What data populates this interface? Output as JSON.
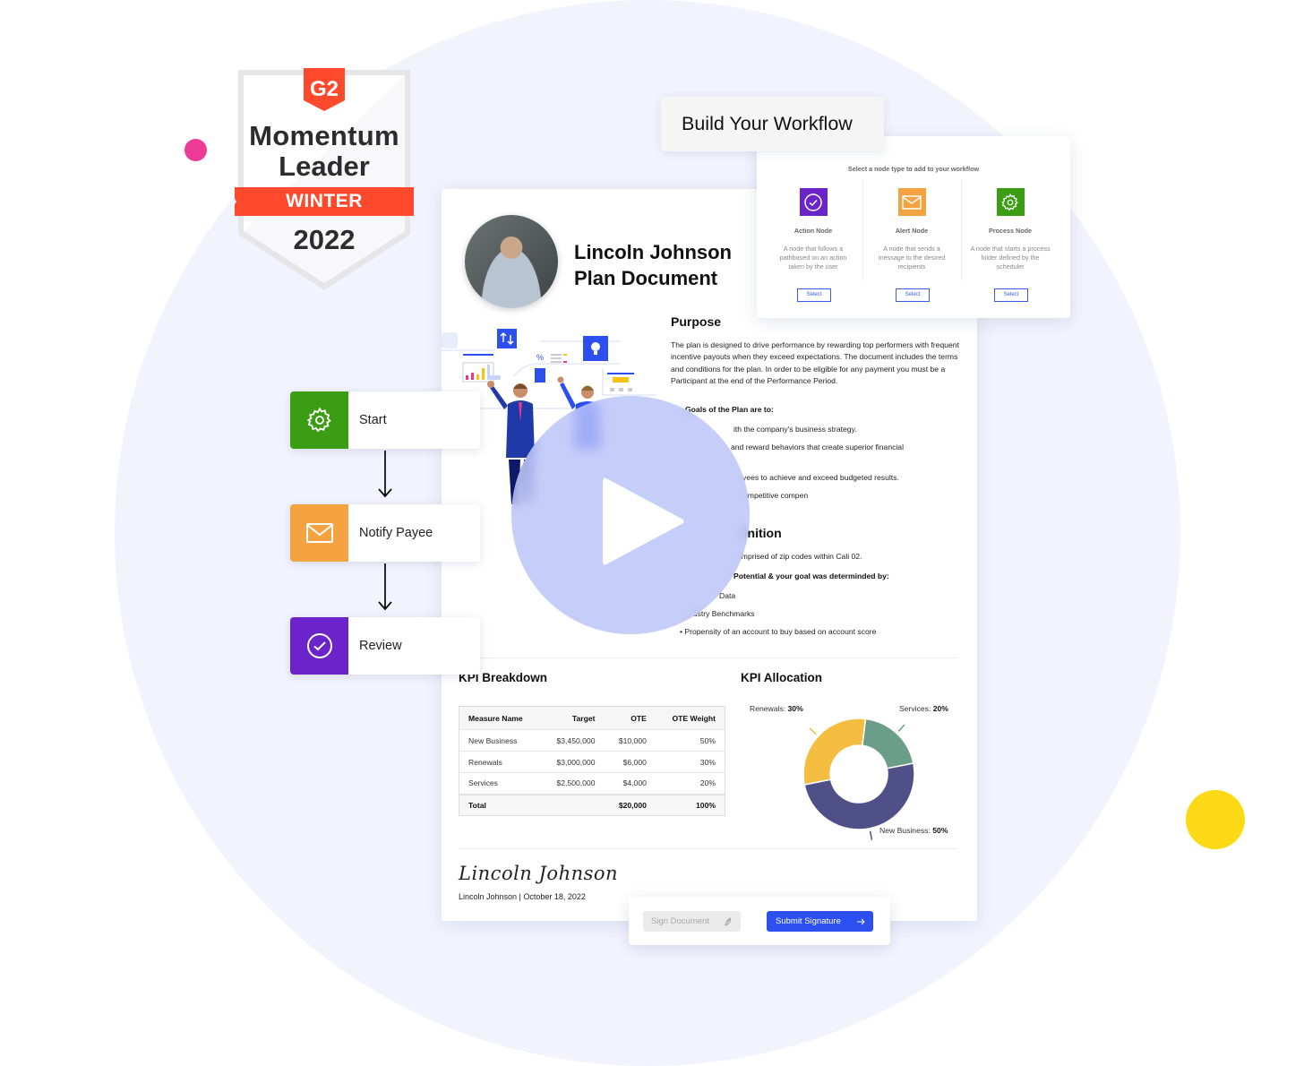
{
  "badge": {
    "brand": "G2",
    "line1": "Momentum",
    "line2": "Leader",
    "season": "WINTER",
    "year": "2022",
    "colors": {
      "red": "#ff492c",
      "text": "#2c2c2c"
    }
  },
  "workflow_builder": {
    "title": "Build Your Workflow",
    "subtitle": "Select a node type to add to your workflow",
    "nodes": [
      {
        "name": "Action Node",
        "icon": "check-circle-icon",
        "color": "#6a24c9",
        "description": "A node that follows a pathbased on an action taken by the user",
        "button": "Select"
      },
      {
        "name": "Alert Node",
        "icon": "mail-icon",
        "color": "#f4a340",
        "description": "A node that sends a message to the desired recipients",
        "button": "Select"
      },
      {
        "name": "Process Node",
        "icon": "gear-icon",
        "color": "#3a9d13",
        "description": "A node that starts a process folder defined by the scheduler",
        "button": "Select"
      }
    ]
  },
  "workflow_steps": [
    {
      "label": "Start",
      "icon": "gear-icon",
      "color": "#3a9d13"
    },
    {
      "label": "Notify Payee",
      "icon": "mail-icon",
      "color": "#f4a340"
    },
    {
      "label": "Review",
      "icon": "check-circle-icon",
      "color": "#6a24c9"
    }
  ],
  "document": {
    "title_line1": "Lincoln Johnson",
    "title_line2": "Plan Document",
    "purpose": {
      "heading": "Purpose",
      "body": "The plan is designed to drive performance by rewarding top performers with frequent incentive payouts when they exceed expectations. The document includes the terms and conditions for the plan. In order to be eligible for any payment you must be a Participant at the end of the Performance Period."
    },
    "goals": {
      "heading": "Goals of the Plan are to:",
      "items": [
        "ith the company's business strategy.",
        "and reward behaviors that create superior financial",
        "yees to achieve and exceed budgeted results.",
        "ompetitive compen"
      ]
    },
    "definition": {
      "heading": "finition",
      "line1": "omprised of zip codes within Cali 02.",
      "line2": "Potential & your goal was determinded by:",
      "bullets": [
        "Data",
        "dustry Benchmarks",
        "Propensity of an account to buy based on account score"
      ]
    },
    "kpi_breakdown": {
      "heading": "KPI Breakdown",
      "columns": [
        "Measure Name",
        "Target",
        "OTE",
        "OTE Weight"
      ],
      "rows": [
        [
          "New Business",
          "$3,450,000",
          "$10,000",
          "50%"
        ],
        [
          "Renewals",
          "$3,000,000",
          "$6,000",
          "30%"
        ],
        [
          "Services",
          "$2,500,000",
          "$4,000",
          "20%"
        ]
      ],
      "total": [
        "Total",
        "",
        "$20,000",
        "100%"
      ]
    },
    "kpi_allocation": {
      "heading": "KPI Allocation",
      "slices": [
        {
          "label": "Services:",
          "value": "20%",
          "pct": 20,
          "color": "#6b9e88"
        },
        {
          "label": "New Business:",
          "value": "50%",
          "pct": 50,
          "color": "#4f5088"
        },
        {
          "label": "Renewals:",
          "value": "30%",
          "pct": 30,
          "color": "#f4bd3f"
        }
      ]
    },
    "signature": {
      "script": "Lincoln Johnson",
      "meta": "Lincoln Johnson | October 18, 2022"
    }
  },
  "sign_bar": {
    "sign_label": "Sign Document",
    "submit_label": "Submit Signature",
    "submit_color": "#2d4ff0"
  },
  "video": {
    "icon": "play-icon"
  }
}
